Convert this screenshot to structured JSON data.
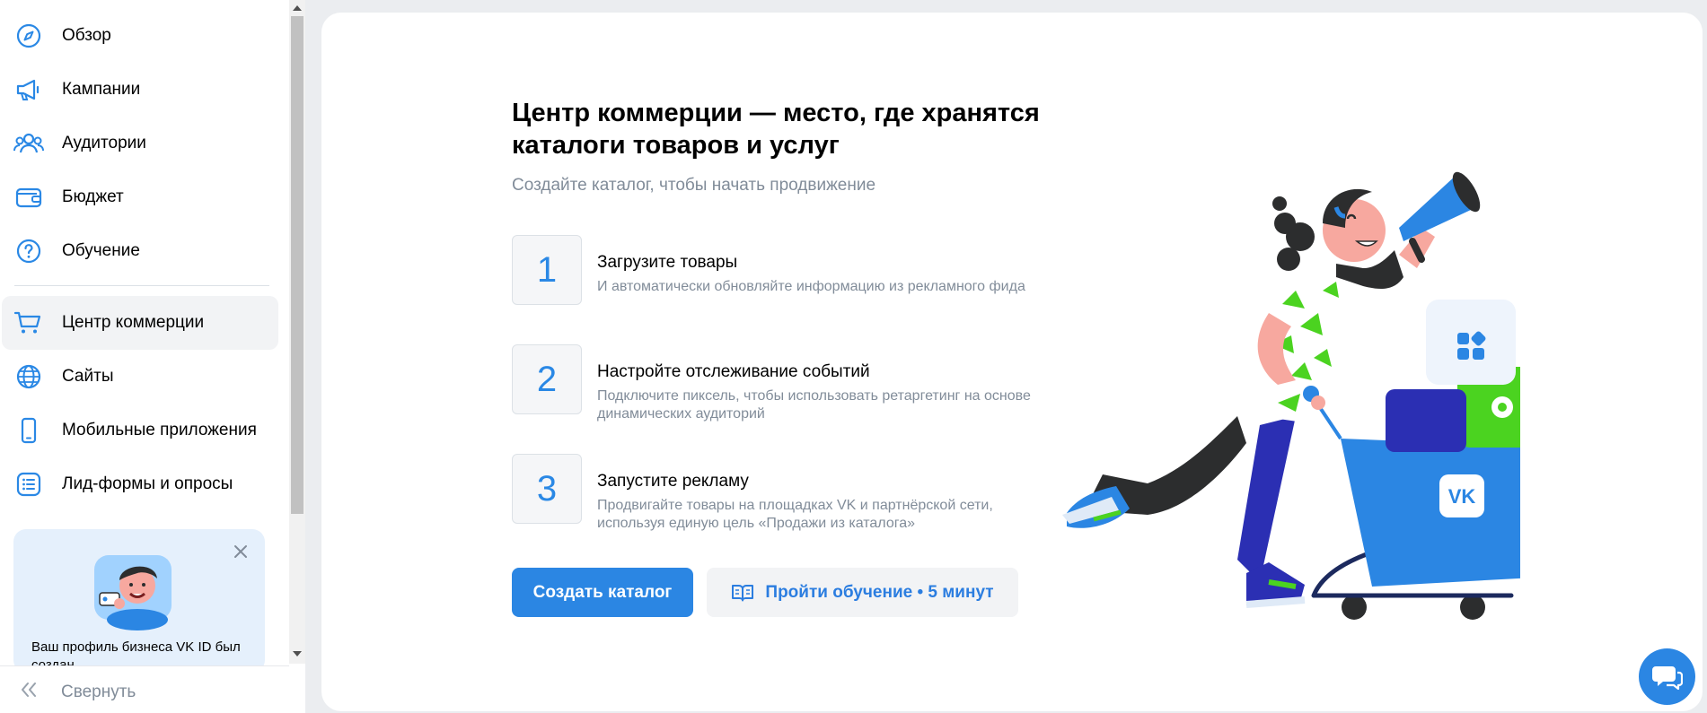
{
  "sidebar": {
    "items": [
      {
        "label": "Обзор",
        "icon": "compass-icon"
      },
      {
        "label": "Кампании",
        "icon": "megaphone-icon"
      },
      {
        "label": "Аудитории",
        "icon": "users-icon"
      },
      {
        "label": "Бюджет",
        "icon": "wallet-icon"
      },
      {
        "label": "Обучение",
        "icon": "help-circle-icon"
      },
      {
        "label": "Центр коммерции",
        "icon": "cart-icon",
        "active": true
      },
      {
        "label": "Сайты",
        "icon": "globe-icon"
      },
      {
        "label": "Мобильные приложения",
        "icon": "smartphone-icon"
      },
      {
        "label": "Лид-формы и опросы",
        "icon": "list-icon"
      }
    ],
    "promo": {
      "text": "Ваш профиль бизнеса VK ID был создан"
    },
    "collapse_label": "Свернуть"
  },
  "main": {
    "title": "Центр коммерции — место, где хранятся каталоги товаров и услуг",
    "subtitle": "Создайте каталог, чтобы начать продвижение",
    "steps": [
      {
        "number": "1",
        "title": "Загрузите товары",
        "description": "И автоматически обновляйте информацию из рекламного фида"
      },
      {
        "number": "2",
        "title": "Настройте отслеживание событий",
        "description": "Подключите пиксель, чтобы использовать ретаргетинг на основе динамических аудиторий"
      },
      {
        "number": "3",
        "title": "Запустите рекламу",
        "description": "Продвигайте товары на площадках VK и партнёрской сети, используя единую цель «Продажи из каталога»"
      }
    ],
    "create_button": "Создать каталог",
    "learn_button": "Пройти обучение • 5 минут"
  },
  "colors": {
    "accent": "#2b86e3",
    "link": "#2b7de0",
    "muted": "#818c99",
    "green": "#4bd320"
  }
}
